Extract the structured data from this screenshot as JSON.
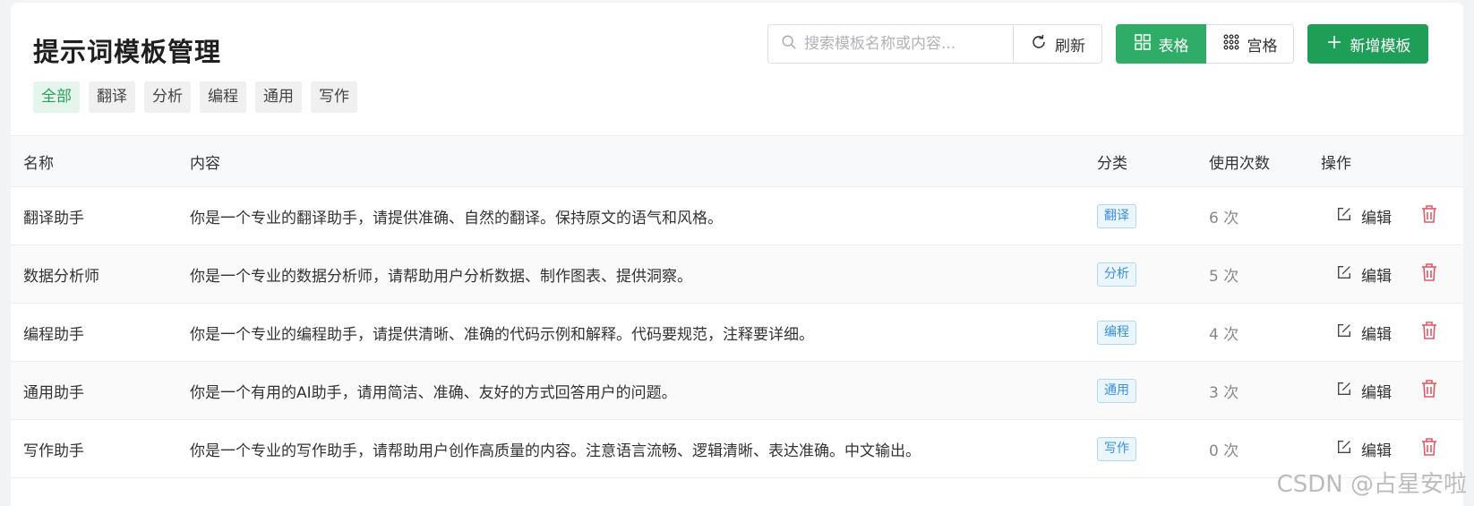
{
  "page": {
    "title": "提示词模板管理"
  },
  "filters": [
    "全部",
    "翻译",
    "分析",
    "编程",
    "通用",
    "写作"
  ],
  "toolbar": {
    "search_placeholder": "搜索模板名称或内容...",
    "refresh_label": "刷新",
    "table_view_label": "表格",
    "grid_view_label": "宫格",
    "add_label": "新增模板"
  },
  "table": {
    "headers": {
      "name": "名称",
      "content": "内容",
      "category": "分类",
      "count": "使用次数",
      "ops": "操作"
    },
    "edit_label": "编辑",
    "rows": [
      {
        "name": "翻译助手",
        "content": "你是一个专业的翻译助手，请提供准确、自然的翻译。保持原文的语气和风格。",
        "category": "翻译",
        "count": "6 次"
      },
      {
        "name": "数据分析师",
        "content": "你是一个专业的数据分析师，请帮助用户分析数据、制作图表、提供洞察。",
        "category": "分析",
        "count": "5 次"
      },
      {
        "name": "编程助手",
        "content": "你是一个专业的编程助手，请提供清晰、准确的代码示例和解释。代码要规范，注释要详细。",
        "category": "编程",
        "count": "4 次"
      },
      {
        "name": "通用助手",
        "content": "你是一个有用的AI助手，请用简洁、准确、友好的方式回答用户的问题。",
        "category": "通用",
        "count": "3 次"
      },
      {
        "name": "写作助手",
        "content": "你是一个专业的写作助手，请帮助用户创作高质量的内容。注意语言流畅、逻辑清晰、表达准确。中文输出。",
        "category": "写作",
        "count": "0 次"
      }
    ]
  },
  "watermark": "CSDN @占星安啦",
  "colors": {
    "primary": "#1f9e58",
    "badge_blue": "#3a8ee6",
    "danger": "#e05a6a"
  }
}
